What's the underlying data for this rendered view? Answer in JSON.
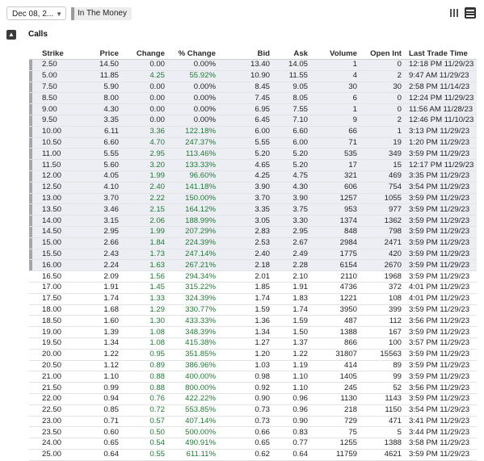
{
  "toolbar": {
    "expiry": "Dec 08, 2...",
    "money_filter": "In The Money",
    "view_icons": [
      "columns-icon",
      "rows-icon"
    ]
  },
  "section": {
    "title": "Calls"
  },
  "columns": [
    "Strike",
    "Price",
    "Change",
    "% Change",
    "Bid",
    "Ask",
    "Volume",
    "Open Int",
    "Last Trade Time"
  ],
  "rows": [
    {
      "itm": true,
      "cells": [
        "2.50",
        "14.50",
        "0.00",
        "0.00%",
        "13.40",
        "14.05",
        "1",
        "0",
        "12:18 PM 11/29/23"
      ]
    },
    {
      "itm": true,
      "cells": [
        "5.00",
        "11.85",
        "4.25",
        "55.92%",
        "10.90",
        "11.55",
        "4",
        "2",
        "9:47 AM 11/29/23"
      ]
    },
    {
      "itm": true,
      "cells": [
        "7.50",
        "5.90",
        "0.00",
        "0.00%",
        "8.45",
        "9.05",
        "30",
        "30",
        "2:58 PM 11/14/23"
      ]
    },
    {
      "itm": true,
      "cells": [
        "8.50",
        "8.00",
        "0.00",
        "0.00%",
        "7.45",
        "8.05",
        "6",
        "0",
        "12:24 PM 11/29/23"
      ]
    },
    {
      "itm": true,
      "cells": [
        "9.00",
        "4.30",
        "0.00",
        "0.00%",
        "6.95",
        "7.55",
        "1",
        "0",
        "11:56 AM 11/28/23"
      ]
    },
    {
      "itm": true,
      "cells": [
        "9.50",
        "3.35",
        "0.00",
        "0.00%",
        "6.45",
        "7.10",
        "9",
        "2",
        "12:46 PM 11/10/23"
      ]
    },
    {
      "itm": true,
      "cells": [
        "10.00",
        "6.11",
        "3.36",
        "122.18%",
        "6.00",
        "6.60",
        "66",
        "1",
        "3:13 PM 11/29/23"
      ]
    },
    {
      "itm": true,
      "cells": [
        "10.50",
        "6.60",
        "4.70",
        "247.37%",
        "5.55",
        "6.00",
        "71",
        "19",
        "1:20 PM 11/29/23"
      ]
    },
    {
      "itm": true,
      "cells": [
        "11.00",
        "5.55",
        "2.95",
        "113.46%",
        "5.20",
        "5.20",
        "535",
        "349",
        "3:59 PM 11/29/23"
      ]
    },
    {
      "itm": true,
      "cells": [
        "11.50",
        "5.60",
        "3.20",
        "133.33%",
        "4.65",
        "5.20",
        "17",
        "15",
        "12:17 PM 11/29/23"
      ]
    },
    {
      "itm": true,
      "cells": [
        "12.00",
        "4.05",
        "1.99",
        "96.60%",
        "4.25",
        "4.75",
        "321",
        "469",
        "3:35 PM 11/29/23"
      ]
    },
    {
      "itm": true,
      "cells": [
        "12.50",
        "4.10",
        "2.40",
        "141.18%",
        "3.90",
        "4.30",
        "606",
        "754",
        "3:54 PM 11/29/23"
      ]
    },
    {
      "itm": true,
      "cells": [
        "13.00",
        "3.70",
        "2.22",
        "150.00%",
        "3.70",
        "3.90",
        "1257",
        "1055",
        "3:59 PM 11/29/23"
      ]
    },
    {
      "itm": true,
      "cells": [
        "13.50",
        "3.46",
        "2.15",
        "164.12%",
        "3.35",
        "3.75",
        "953",
        "977",
        "3:59 PM 11/29/23"
      ]
    },
    {
      "itm": true,
      "cells": [
        "14.00",
        "3.15",
        "2.06",
        "188.99%",
        "3.05",
        "3.30",
        "1374",
        "1362",
        "3:59 PM 11/29/23"
      ]
    },
    {
      "itm": true,
      "cells": [
        "14.50",
        "2.95",
        "1.99",
        "207.29%",
        "2.83",
        "2.95",
        "848",
        "798",
        "3:59 PM 11/29/23"
      ]
    },
    {
      "itm": true,
      "cells": [
        "15.00",
        "2.66",
        "1.84",
        "224.39%",
        "2.53",
        "2.67",
        "2984",
        "2471",
        "3:59 PM 11/29/23"
      ]
    },
    {
      "itm": true,
      "cells": [
        "15.50",
        "2.43",
        "1.73",
        "247.14%",
        "2.40",
        "2.49",
        "1775",
        "420",
        "3:59 PM 11/29/23"
      ]
    },
    {
      "itm": true,
      "cells": [
        "16.00",
        "2.24",
        "1.63",
        "267.21%",
        "2.18",
        "2.28",
        "6154",
        "2670",
        "3:59 PM 11/29/23"
      ]
    },
    {
      "itm": false,
      "cells": [
        "16.50",
        "2.09",
        "1.56",
        "294.34%",
        "2.01",
        "2.10",
        "2110",
        "1968",
        "3:59 PM 11/29/23"
      ]
    },
    {
      "itm": false,
      "cells": [
        "17.00",
        "1.91",
        "1.45",
        "315.22%",
        "1.85",
        "1.91",
        "4736",
        "372",
        "4:01 PM 11/29/23"
      ]
    },
    {
      "itm": false,
      "cells": [
        "17.50",
        "1.74",
        "1.33",
        "324.39%",
        "1.74",
        "1.83",
        "1221",
        "108",
        "4:01 PM 11/29/23"
      ]
    },
    {
      "itm": false,
      "cells": [
        "18.00",
        "1.68",
        "1.29",
        "330.77%",
        "1.59",
        "1.74",
        "3950",
        "399",
        "3:59 PM 11/29/23"
      ]
    },
    {
      "itm": false,
      "cells": [
        "18.50",
        "1.60",
        "1.30",
        "433.33%",
        "1.36",
        "1.59",
        "487",
        "112",
        "3:56 PM 11/29/23"
      ]
    },
    {
      "itm": false,
      "cells": [
        "19.00",
        "1.39",
        "1.08",
        "348.39%",
        "1.34",
        "1.50",
        "1388",
        "167",
        "3:59 PM 11/29/23"
      ]
    },
    {
      "itm": false,
      "cells": [
        "19.50",
        "1.34",
        "1.08",
        "415.38%",
        "1.27",
        "1.37",
        "866",
        "100",
        "3:57 PM 11/29/23"
      ]
    },
    {
      "itm": false,
      "cells": [
        "20.00",
        "1.22",
        "0.95",
        "351.85%",
        "1.20",
        "1.22",
        "31807",
        "15563",
        "3:59 PM 11/29/23"
      ]
    },
    {
      "itm": false,
      "cells": [
        "20.50",
        "1.12",
        "0.89",
        "386.96%",
        "1.03",
        "1.19",
        "414",
        "89",
        "3:59 PM 11/29/23"
      ]
    },
    {
      "itm": false,
      "cells": [
        "21.00",
        "1.10",
        "0.88",
        "400.00%",
        "0.98",
        "1.10",
        "1405",
        "99",
        "3:59 PM 11/29/23"
      ]
    },
    {
      "itm": false,
      "cells": [
        "21.50",
        "0.99",
        "0.88",
        "800.00%",
        "0.92",
        "1.10",
        "245",
        "52",
        "3:56 PM 11/29/23"
      ]
    },
    {
      "itm": false,
      "cells": [
        "22.00",
        "0.94",
        "0.76",
        "422.22%",
        "0.90",
        "0.96",
        "1130",
        "1143",
        "3:59 PM 11/29/23"
      ]
    },
    {
      "itm": false,
      "cells": [
        "22.50",
        "0.85",
        "0.72",
        "553.85%",
        "0.73",
        "0.96",
        "218",
        "1150",
        "3:54 PM 11/29/23"
      ]
    },
    {
      "itm": false,
      "cells": [
        "23.00",
        "0.71",
        "0.57",
        "407.14%",
        "0.73",
        "0.90",
        "729",
        "471",
        "3:41 PM 11/29/23"
      ]
    },
    {
      "itm": false,
      "cells": [
        "23.50",
        "0.60",
        "0.50",
        "500.00%",
        "0.66",
        "0.83",
        "75",
        "5",
        "3:44 PM 11/29/23"
      ]
    },
    {
      "itm": false,
      "cells": [
        "24.00",
        "0.65",
        "0.54",
        "490.91%",
        "0.65",
        "0.77",
        "1255",
        "1388",
        "3:58 PM 11/29/23"
      ]
    },
    {
      "itm": false,
      "cells": [
        "25.00",
        "0.64",
        "0.55",
        "611.11%",
        "0.62",
        "0.64",
        "11759",
        "4621",
        "3:59 PM 11/29/23"
      ]
    }
  ],
  "colors": {
    "positive": "#1f7a34",
    "itm_background": "#eceef4",
    "itm_marker": "#a6a6a6"
  }
}
